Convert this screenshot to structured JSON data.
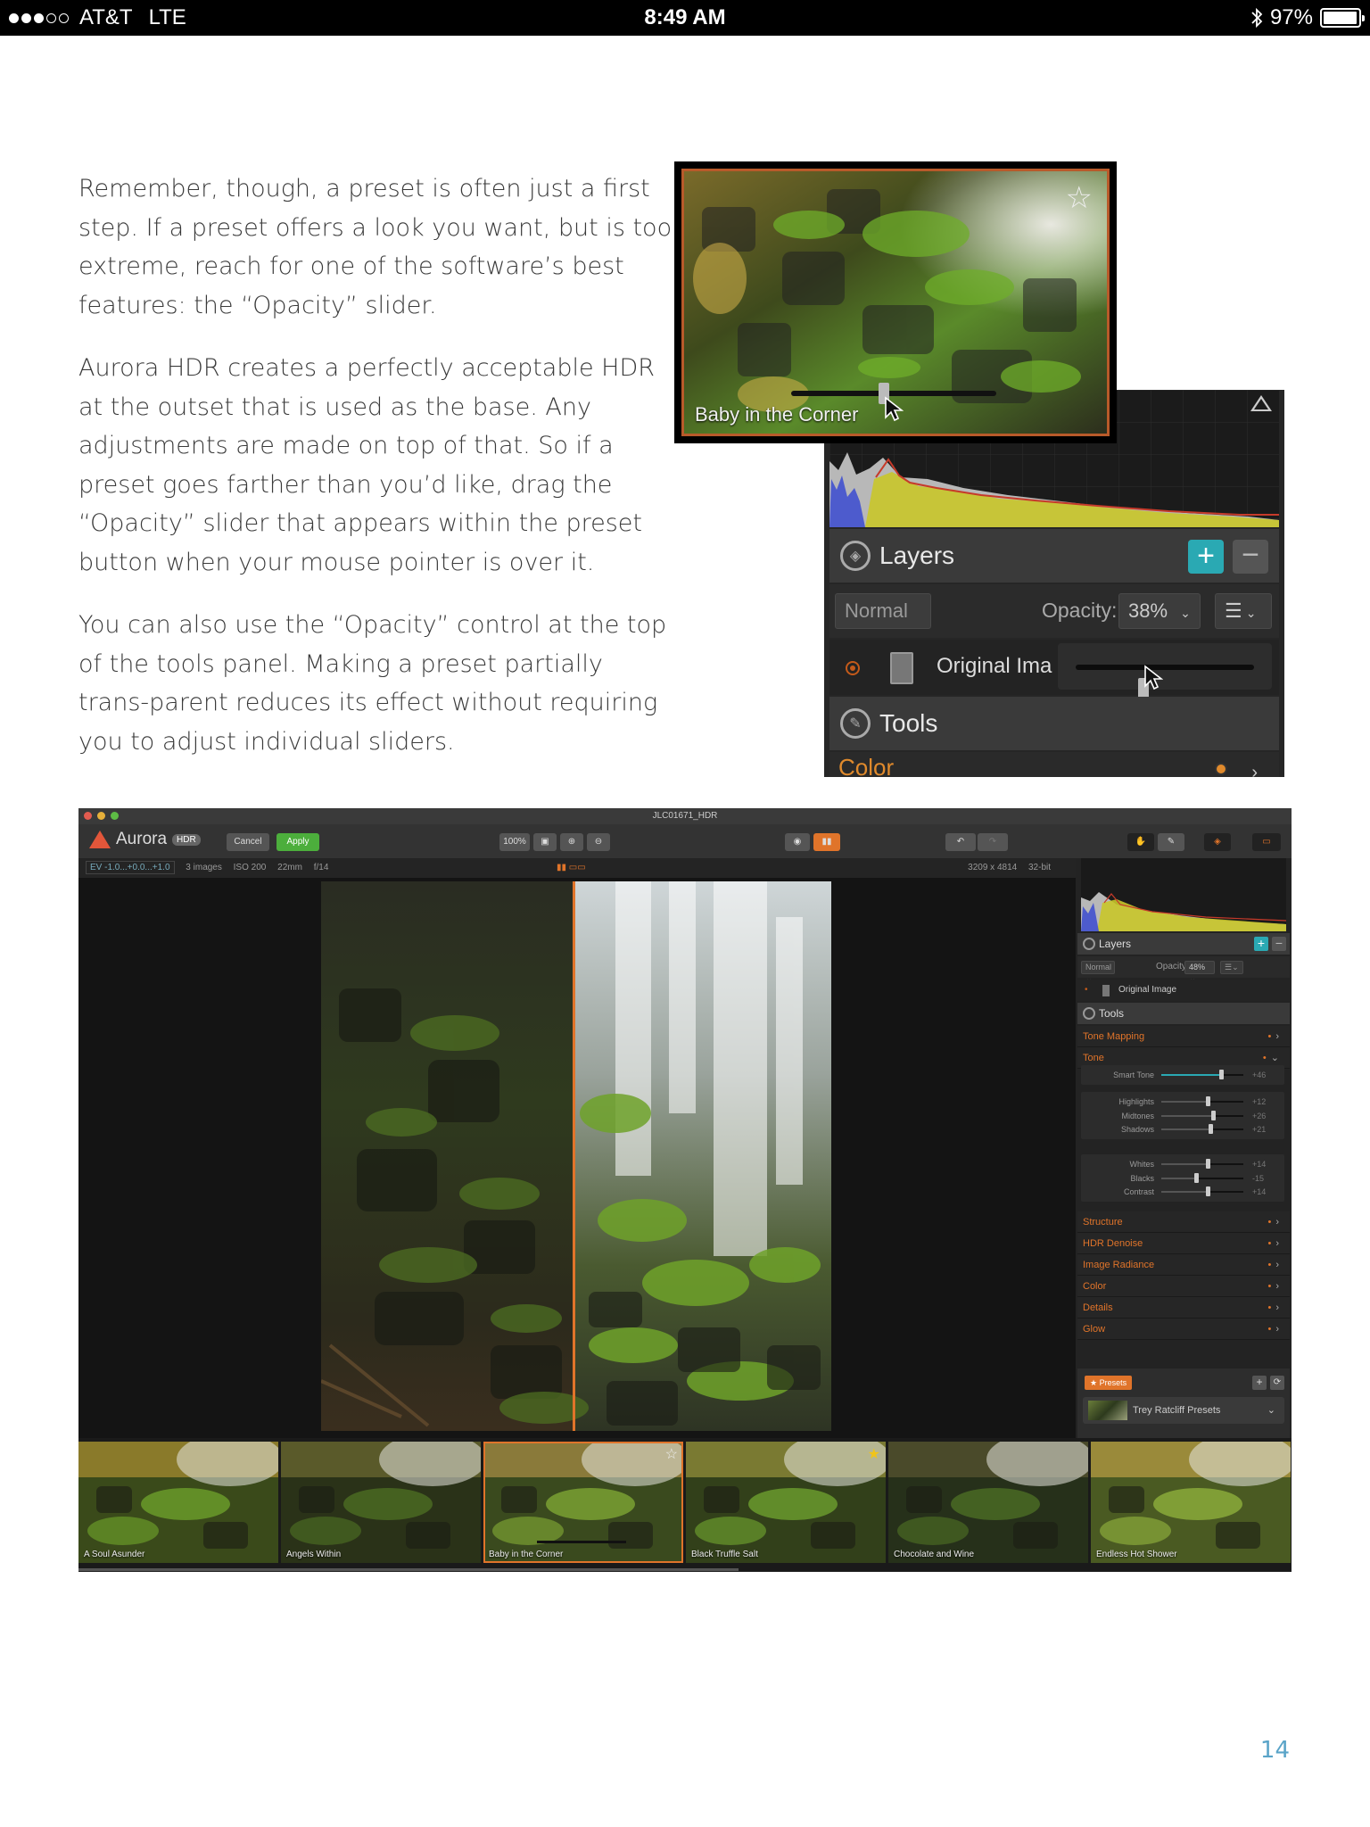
{
  "status_bar": {
    "carrier": "AT&T",
    "network": "LTE",
    "time": "8:49 AM",
    "battery": "97%",
    "battery_level": 0.97,
    "signal_bars_filled": 3,
    "signal_bars_total": 5
  },
  "article": {
    "paragraphs": [
      "Remember, though, a preset is often just a first step. If a preset offers a look you want, but is too extreme, reach for one of the software’s best features: the “Opacity” slider.",
      "Aurora HDR creates a perfectly acceptable HDR at the outset that is used as the base. Any adjustments are made on top of that. So if a preset goes farther than you’d like, drag the “Opacity” slider that appears within the preset button when your mouse pointer is over it.",
      "You can also use the “Opacity” control at the top of the tools panel. Making a preset partially trans-parent reduces its effect without requiring you to adjust individual sliders."
    ],
    "page_number": "14"
  },
  "inset_preset": {
    "caption": "Baby in the Corner",
    "opacity_fraction": 0.45
  },
  "inset_layers": {
    "layers_title": "Layers",
    "blend_mode": "Normal",
    "opacity_label": "Opacity:",
    "opacity_value": "38%",
    "layer_name": "Original Image",
    "tools_title": "Tools",
    "first_tool": "Color",
    "opacity_fraction": 0.38
  },
  "app": {
    "window_title": "JLC01671_HDR",
    "logo_text": "Aurora",
    "logo_badge": "HDR",
    "cancel_label": "Cancel",
    "apply_label": "Apply",
    "zoom_label": "100%",
    "info": {
      "ev": "EV -1.0...+0.0...+1.0",
      "images": "3 images",
      "iso": "ISO 200",
      "focal": "22mm",
      "aperture": "f/14",
      "dimensions": "3209 x 4814",
      "bit_depth": "32-bit"
    },
    "panel": {
      "layers_title": "Layers",
      "blend_mode": "Normal",
      "opacity_label": "Opacity:",
      "opacity_value": "48%",
      "layer_name": "Original Image",
      "tools_title": "Tools",
      "sections_top": [
        "Tone Mapping",
        "Tone"
      ],
      "sliders": [
        {
          "label": "Smart Tone",
          "value": "+46",
          "pos": 0.73
        },
        {
          "label": "Highlights",
          "value": "+12",
          "pos": 0.56
        },
        {
          "label": "Midtones",
          "value": "+26",
          "pos": 0.63
        },
        {
          "label": "Shadows",
          "value": "+21",
          "pos": 0.6
        },
        {
          "label": "Whites",
          "value": "+14",
          "pos": 0.57
        },
        {
          "label": "Blacks",
          "value": "-15",
          "pos": 0.42
        },
        {
          "label": "Contrast",
          "value": "+14",
          "pos": 0.57
        }
      ],
      "sections_bottom": [
        "Structure",
        "HDR Denoise",
        "Image Radiance",
        "Color",
        "Details",
        "Glow"
      ],
      "presets_tag": "Presets",
      "preset_collection": "Trey Ratcliff Presets"
    },
    "filmstrip": [
      {
        "label": "A Soul Asunder",
        "star": ""
      },
      {
        "label": "Angels Within",
        "star": ""
      },
      {
        "label": "Baby in the Corner",
        "star": "☆",
        "selected": true
      },
      {
        "label": "Black Truffle Salt",
        "star": "★"
      },
      {
        "label": "Chocolate and Wine",
        "star": ""
      },
      {
        "label": "Endless Hot Shower",
        "star": ""
      }
    ]
  }
}
